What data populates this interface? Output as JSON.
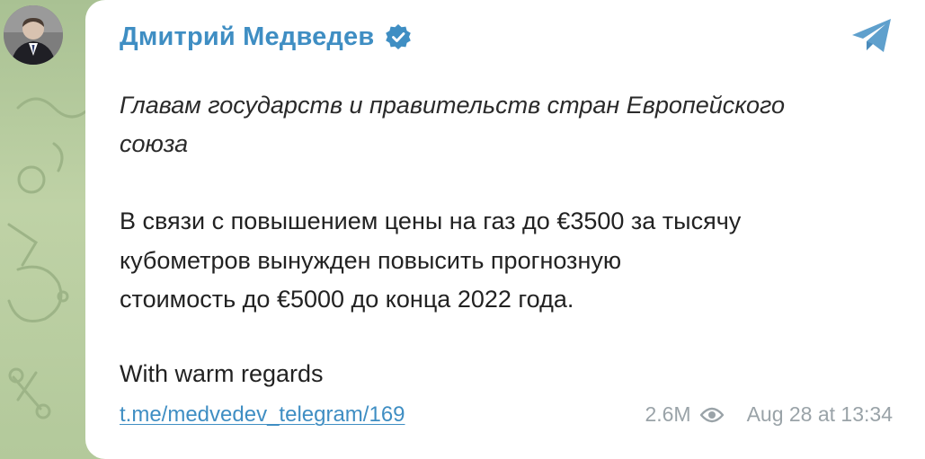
{
  "post": {
    "sender_name": "Дмитрий Медведев",
    "italic_lines": [
      "Главам государств и правительств стран Европейского",
      "союза"
    ],
    "body_lines": [
      "В связи с повышением цены на газ до €3500 за тысячу",
      "кубометров вынужден повысить прогнозную",
      "стоимость до €5000 до конца 2022 года."
    ],
    "signoff": "With warm regards",
    "link": "t.me/medvedev_telegram/169",
    "views": "2.6M",
    "date": "Aug 28 at 13:34"
  },
  "icons": {
    "verified": "verified-badge-icon",
    "share": "telegram-share-icon",
    "views": "eye-icon"
  },
  "colors": {
    "accent": "#3f8ec3",
    "meta": "#9aa3a8",
    "chat_background": "#b7cba0"
  }
}
